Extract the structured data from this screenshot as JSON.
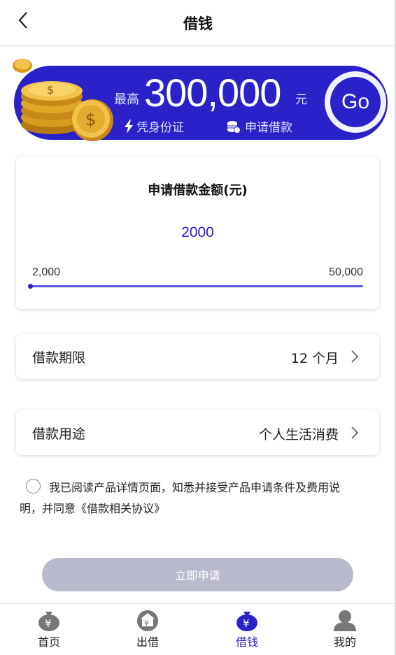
{
  "header": {
    "title": "借钱"
  },
  "banner": {
    "prefix": "最高",
    "amount": "300,000",
    "unit": "元",
    "tag1": "凭身份证",
    "tag2": "申请借款",
    "go_label": "Go"
  },
  "amount_card": {
    "title": "申请借款金额(元)",
    "value": "2000",
    "min_label": "2,000",
    "max_label": "50,000",
    "slider_fraction": 0
  },
  "term": {
    "label": "借款期限",
    "value": "12 个月"
  },
  "purpose": {
    "label": "借款用途",
    "value": "个人生活消费"
  },
  "agreement": {
    "line1": "我已阅读产品详情页面，知悉并接受产品申请条件及费用说",
    "line2": "明，并同意《借款相关协议》",
    "checked": false
  },
  "submit": {
    "label": "立即申请"
  },
  "tabbar": {
    "tabs": [
      {
        "label": "首页",
        "icon": "money-bag-icon",
        "active": false
      },
      {
        "label": "出借",
        "icon": "house-yen-icon",
        "active": false
      },
      {
        "label": "借钱",
        "icon": "money-bag-icon",
        "active": true
      },
      {
        "label": "我的",
        "icon": "user-icon",
        "active": false
      }
    ]
  },
  "colors": {
    "accent": "#2a21c9",
    "button_disabled": "#b9bacb",
    "icon_gray": "#777777"
  }
}
